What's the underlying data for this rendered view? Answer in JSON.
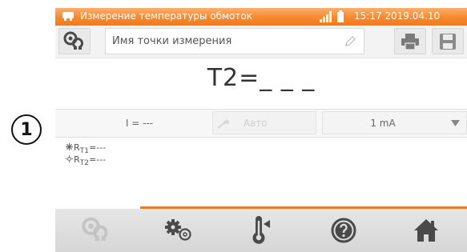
{
  "callout": {
    "number": "1"
  },
  "statusbar": {
    "title": "Измерение температуры обмоток",
    "clock": "15:17 2019.04.10",
    "icons": [
      "app-icon",
      "signal-icon",
      "battery-icon"
    ]
  },
  "toolbar": {
    "point_name_placeholder": "Имя точки измерения",
    "icons": [
      "ohm-probe-icon",
      "pencil-icon",
      "printer-icon",
      "save-icon"
    ]
  },
  "measurement": {
    "main_value": "T2=_ _ _"
  },
  "params": {
    "current_label": "I = ---",
    "auto_label": "Авто",
    "range_value": "1 mA"
  },
  "results": {
    "rt1": "R",
    "rt1_sub": "T1",
    "rt1_value": "=---",
    "rt2": "R",
    "rt2_sub": "T2",
    "rt2_value": "=---"
  },
  "nav": {
    "items": [
      "ohm-probe-icon",
      "settings-gears-icon",
      "thermometer-icon",
      "help-icon",
      "home-icon"
    ]
  },
  "colors": {
    "accent": "#f17a1e",
    "nav_bg": "#dcdcdc",
    "icon_dark": "#4a4a4a",
    "icon_disabled": "#bdbdbd"
  }
}
